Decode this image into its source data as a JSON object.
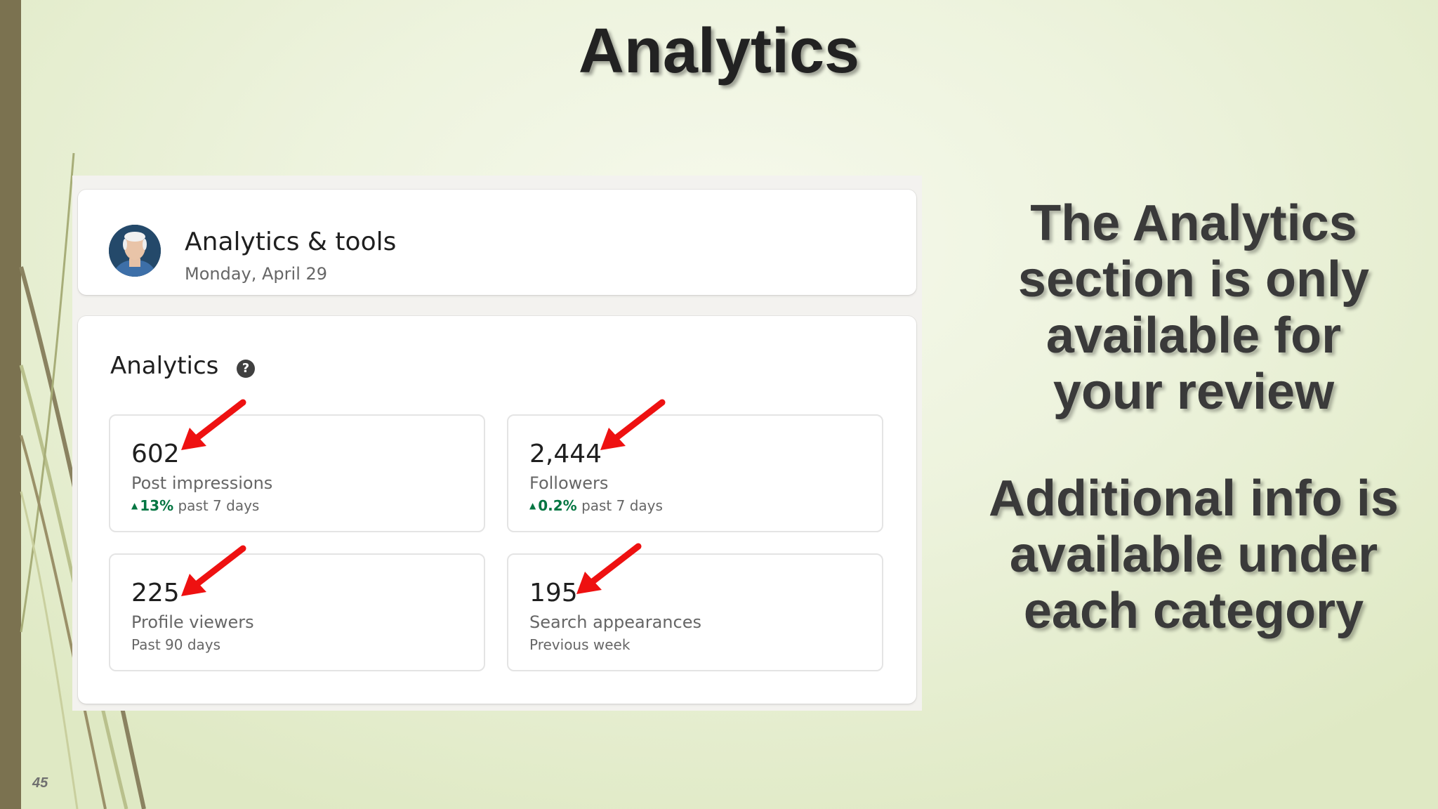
{
  "slide": {
    "title": "Analytics",
    "side_text_1": [
      "The Analytics",
      "section is only",
      "available for",
      "your review"
    ],
    "side_text_2": [
      "Additional info is",
      "available under",
      "each category"
    ],
    "page_number": "45",
    "colors": {
      "left_bar": "#7b7250",
      "arrow": "#ee1111",
      "positive_change": "#057642"
    }
  },
  "screenshot": {
    "header": {
      "title": "Analytics & tools",
      "date": "Monday, April 29",
      "avatar_icon": "profile-photo"
    },
    "analytics": {
      "title": "Analytics",
      "help_icon": "?",
      "metrics": [
        {
          "value": "602",
          "label": "Post impressions",
          "change": "13%",
          "period": "past 7 days"
        },
        {
          "value": "2,444",
          "label": "Followers",
          "change": "0.2%",
          "period": "past 7 days"
        },
        {
          "value": "225",
          "label": "Profile viewers",
          "period": "Past 90 days"
        },
        {
          "value": "195",
          "label": "Search appearances",
          "period": "Previous week"
        }
      ]
    }
  }
}
